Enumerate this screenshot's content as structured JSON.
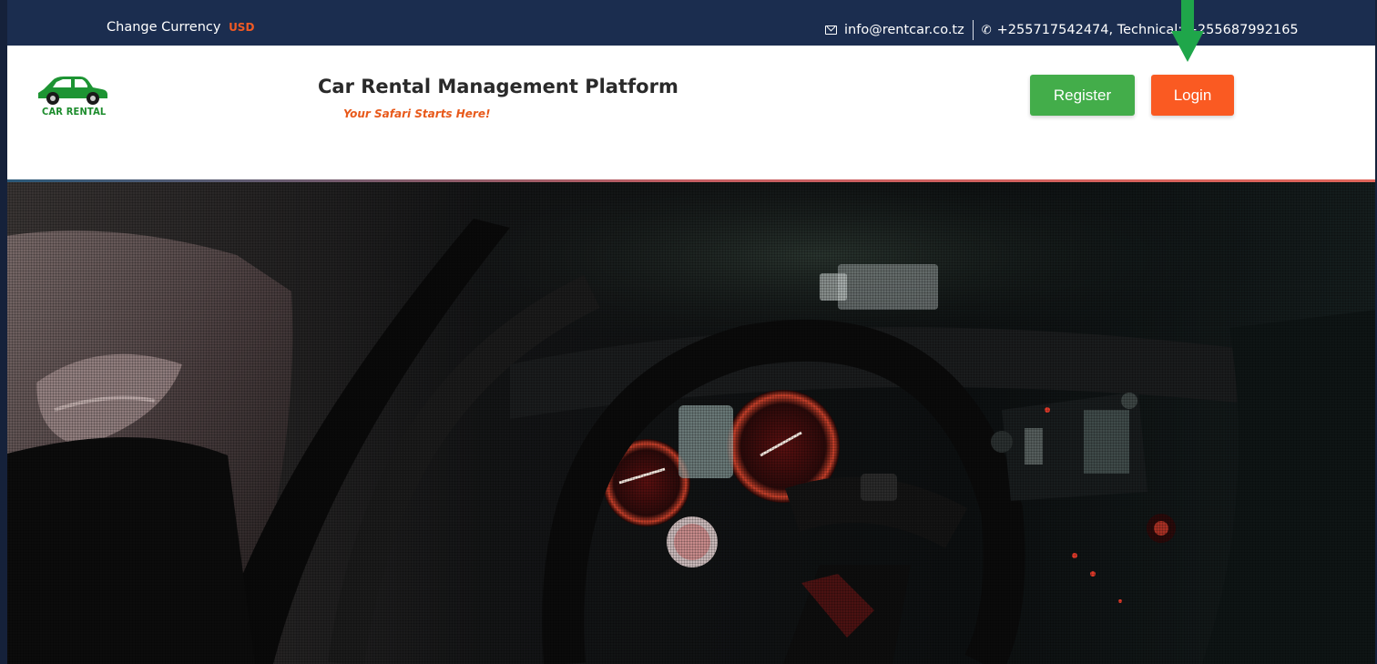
{
  "topbar": {
    "currency_label": "Change Currency",
    "currency_value": "USD",
    "email": "info@rentcar.co.tz",
    "phone": "+255717542474, Technical: +255687992165"
  },
  "header": {
    "logo_text": "CAR RENTAL",
    "title": "Car Rental Management Platform",
    "tagline": "Your Safari Starts Here!",
    "register_label": "Register",
    "login_label": "Login"
  },
  "colors": {
    "topbar_bg": "#1b2d4f",
    "accent_orange": "#fa5a22",
    "accent_green": "#43ad4a",
    "arrow_green": "#1fa64a"
  },
  "icons": {
    "email": "envelope-icon",
    "phone": "phone-icon",
    "indicator": "arrow-down-icon"
  }
}
